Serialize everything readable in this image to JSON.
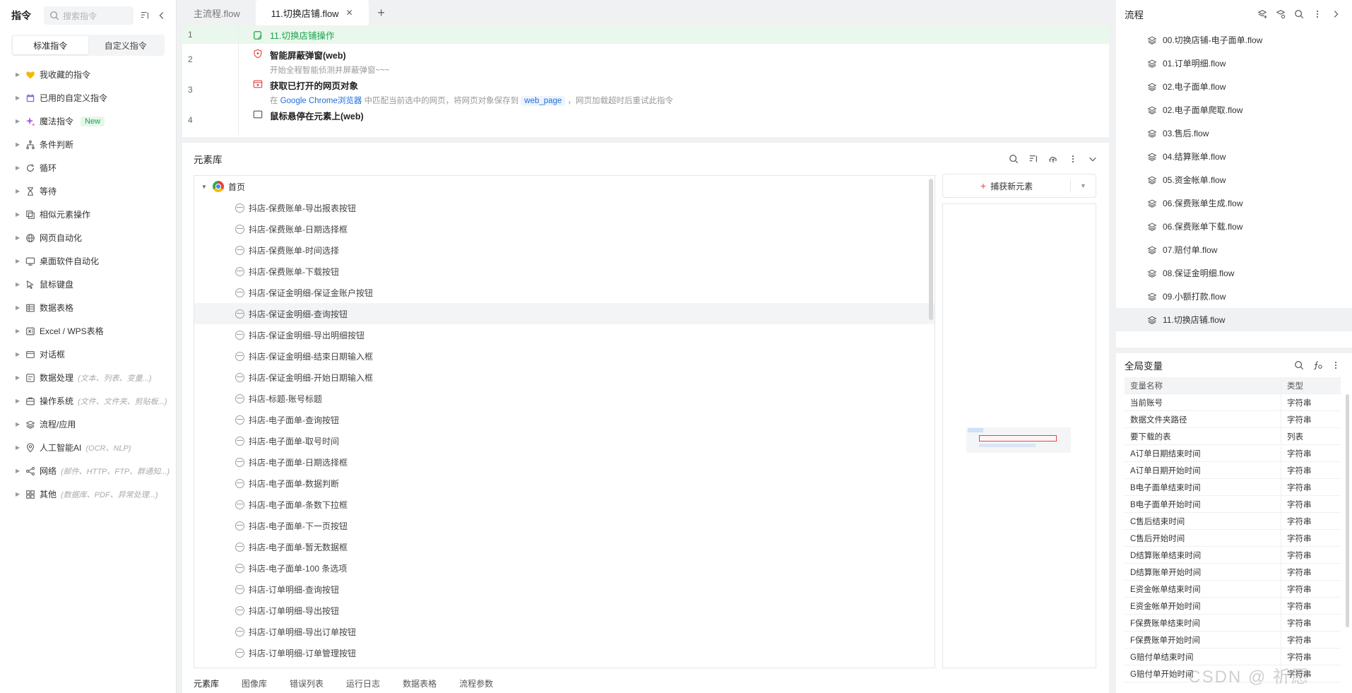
{
  "left": {
    "title": "指令",
    "search_placeholder": "搜索指令",
    "seg": {
      "standard": "标准指令",
      "custom": "自定义指令"
    },
    "items": [
      {
        "label": "我收藏的指令",
        "icon": "heart-icon",
        "hint": "",
        "badge": ""
      },
      {
        "label": "已用的自定义指令",
        "icon": "calendar-icon",
        "hint": "",
        "badge": ""
      },
      {
        "label": "魔法指令",
        "icon": "sparkle-icon",
        "hint": "",
        "badge": "New"
      },
      {
        "label": "条件判断",
        "icon": "branch-icon",
        "hint": "",
        "badge": ""
      },
      {
        "label": "循环",
        "icon": "loop-icon",
        "hint": "",
        "badge": ""
      },
      {
        "label": "等待",
        "icon": "hourglass-icon",
        "hint": "",
        "badge": ""
      },
      {
        "label": "相似元素操作",
        "icon": "similar-icon",
        "hint": "",
        "badge": ""
      },
      {
        "label": "网页自动化",
        "icon": "globe-icon",
        "hint": "",
        "badge": ""
      },
      {
        "label": "桌面软件自动化",
        "icon": "monitor-icon",
        "hint": "",
        "badge": ""
      },
      {
        "label": "鼠标键盘",
        "icon": "cursor-icon",
        "hint": "",
        "badge": ""
      },
      {
        "label": "数据表格",
        "icon": "table-icon",
        "hint": "",
        "badge": ""
      },
      {
        "label": "Excel / WPS表格",
        "icon": "excel-icon",
        "hint": "",
        "badge": ""
      },
      {
        "label": "对话框",
        "icon": "dialog-icon",
        "hint": "",
        "badge": ""
      },
      {
        "label": "数据处理",
        "icon": "data-icon",
        "hint": "(文本、列表、变量...)",
        "badge": ""
      },
      {
        "label": "操作系统",
        "icon": "os-icon",
        "hint": "(文件、文件夹、剪贴板...)",
        "badge": ""
      },
      {
        "label": "流程/应用",
        "icon": "layers-icon",
        "hint": "",
        "badge": ""
      },
      {
        "label": "人工智能AI",
        "icon": "ai-icon",
        "hint": "(OCR、NLP)",
        "badge": ""
      },
      {
        "label": "网络",
        "icon": "network-icon",
        "hint": "(邮件、HTTP、FTP、群通知...)",
        "badge": ""
      },
      {
        "label": "其他",
        "icon": "grid-icon",
        "hint": "(数据库、PDF、异常处理...)",
        "badge": ""
      }
    ]
  },
  "tabs": [
    {
      "label": "主流程.flow",
      "active": false
    },
    {
      "label": "11.切换店铺.flow",
      "active": true
    }
  ],
  "editor": {
    "rows": [
      {
        "num": "1",
        "title": "11.切换店铺操作",
        "desc": ""
      },
      {
        "num": "2",
        "title": "智能屏蔽弹窗(web)",
        "desc": "开始全程智能侦测并屏蔽弹窗~~~"
      },
      {
        "num": "3",
        "title": "获取已打开的网页对象",
        "desc_pre": "在 ",
        "desc_link": "Google Chrome浏览器",
        "desc_mid": " 中匹配当前选中的网页，将网页对象保存到 ",
        "desc_var": "web_page",
        "desc_post": " ，网页加载超时后重试此指令"
      },
      {
        "num": "4",
        "title": "鼠标悬停在元素上(web)",
        "desc": ""
      }
    ]
  },
  "lib": {
    "title": "元素库",
    "root": "首页",
    "capture": "捕获新元素",
    "items": [
      "抖店-保费账单-导出报表按钮",
      "抖店-保费账单-日期选择框",
      "抖店-保费账单-时间选择",
      "抖店-保费账单-下载按钮",
      "抖店-保证金明细-保证金账户按钮",
      "抖店-保证金明细-查询按钮",
      "抖店-保证金明细-导出明细按钮",
      "抖店-保证金明细-结束日期输入框",
      "抖店-保证金明细-开始日期输入框",
      "抖店-标题-账号标题",
      "抖店-电子面单-查询按钮",
      "抖店-电子面单-取号时间",
      "抖店-电子面单-日期选择框",
      "抖店-电子面单-数据判断",
      "抖店-电子面单-条数下拉框",
      "抖店-电子面单-下一页按钮",
      "抖店-电子面单-暂无数据框",
      "抖店-电子面单-100 条选项",
      "抖店-订单明细-查询按钮",
      "抖店-订单明细-导出按钮",
      "抖店-订单明细-导出订单按钮",
      "抖店-订单明细-订单管理按钮"
    ],
    "selected_index": 5,
    "bottom_tabs": [
      "元素库",
      "图像库",
      "错误列表",
      "运行日志",
      "数据表格",
      "流程参数"
    ]
  },
  "flow": {
    "title": "流程",
    "items": [
      "00.切换店铺-电子面单.flow",
      "01.订单明细.flow",
      "02.电子面单.flow",
      "02.电子面单爬取.flow",
      "03.售后.flow",
      "04.结算账单.flow",
      "05.资金帐单.flow",
      "06.保费账单生成.flow",
      "06.保费账单下载.flow",
      "07.赔付单.flow",
      "08.保证金明细.flow",
      "09.小额打款.flow",
      "11.切换店铺.flow"
    ],
    "active_index": 12
  },
  "vars": {
    "title": "全局变量",
    "headers": {
      "name": "变量名称",
      "type": "类型"
    },
    "rows": [
      {
        "name": "当前账号",
        "type": "字符串"
      },
      {
        "name": "数据文件夹路径",
        "type": "字符串"
      },
      {
        "name": "要下载的表",
        "type": "列表"
      },
      {
        "name": "A订单日期结束时间",
        "type": "字符串"
      },
      {
        "name": "A订单日期开始时间",
        "type": "字符串"
      },
      {
        "name": "B电子面单结束时间",
        "type": "字符串"
      },
      {
        "name": "B电子面单开始时间",
        "type": "字符串"
      },
      {
        "name": "C售后结束时间",
        "type": "字符串"
      },
      {
        "name": "C售后开始时间",
        "type": "字符串"
      },
      {
        "name": "D结算账单结束时间",
        "type": "字符串"
      },
      {
        "name": "D结算账单开始时间",
        "type": "字符串"
      },
      {
        "name": "E资金帐单结束时间",
        "type": "字符串"
      },
      {
        "name": "E资金帐单开始时间",
        "type": "字符串"
      },
      {
        "name": "F保费账单结束时间",
        "type": "字符串"
      },
      {
        "name": "F保费账单开始时间",
        "type": "字符串"
      },
      {
        "name": "G赔付单结束时间",
        "type": "字符串"
      },
      {
        "name": "G赔付单开始时间",
        "type": "字符串"
      }
    ]
  },
  "watermark": "CSDN @ 祈愿"
}
